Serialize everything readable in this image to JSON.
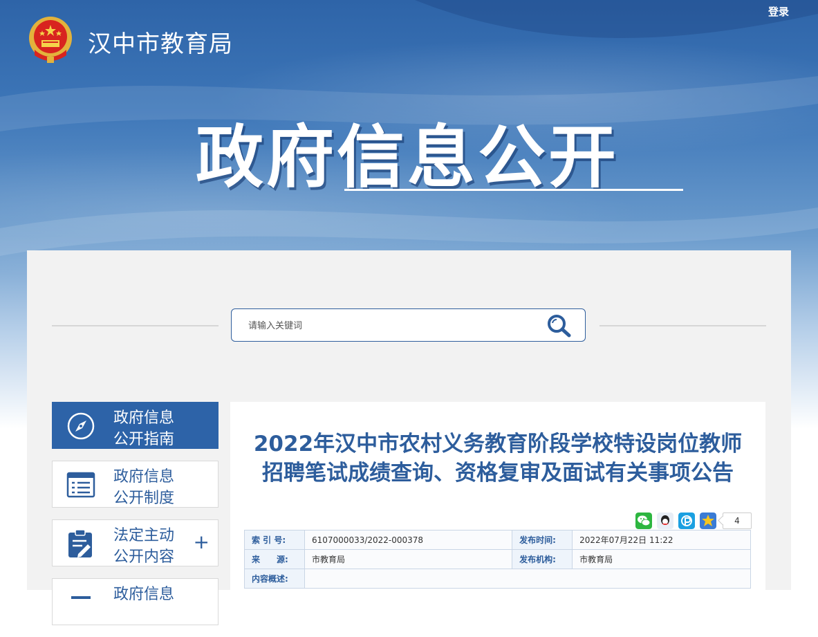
{
  "header": {
    "site_title": "汉中市教育局",
    "login_label": "登录",
    "banner_title": "政府信息公开"
  },
  "search": {
    "placeholder": "请输入关键词"
  },
  "nav": {
    "items": [
      {
        "label_line1": "政府信息",
        "label_line2": "公开指南",
        "icon": "compass-icon",
        "active": true
      },
      {
        "label_line1": "政府信息",
        "label_line2": "公开制度",
        "icon": "document-list-icon",
        "active": false
      },
      {
        "label_line1": "法定主动",
        "label_line2": "公开内容",
        "icon": "clipboard-edit-icon",
        "active": false,
        "expand": "+"
      },
      {
        "label_line1": "政府信息",
        "label_line2": "",
        "icon": "info-icon",
        "active": false
      }
    ]
  },
  "article": {
    "title_line1": "2022年汉中市农村义务教育阶段学校特设岗位教师",
    "title_line2": "招聘笔试成绩查询、资格复审及面试有关事项公告",
    "share_count": "4",
    "meta": {
      "index_label": "索 引 号:",
      "index_value": "6107000033/2022-000378",
      "publish_time_label": "发布时间:",
      "publish_time_value": "2022年07月22日 11:22",
      "source_label": "来　　源:",
      "source_value": "市教育局",
      "publisher_label": "发布机构:",
      "publisher_value": "市教育局",
      "summary_label": "内容概述:",
      "summary_value": ""
    }
  },
  "colors": {
    "brand_blue": "#2d63a8",
    "text_blue": "#2d5d9c"
  }
}
